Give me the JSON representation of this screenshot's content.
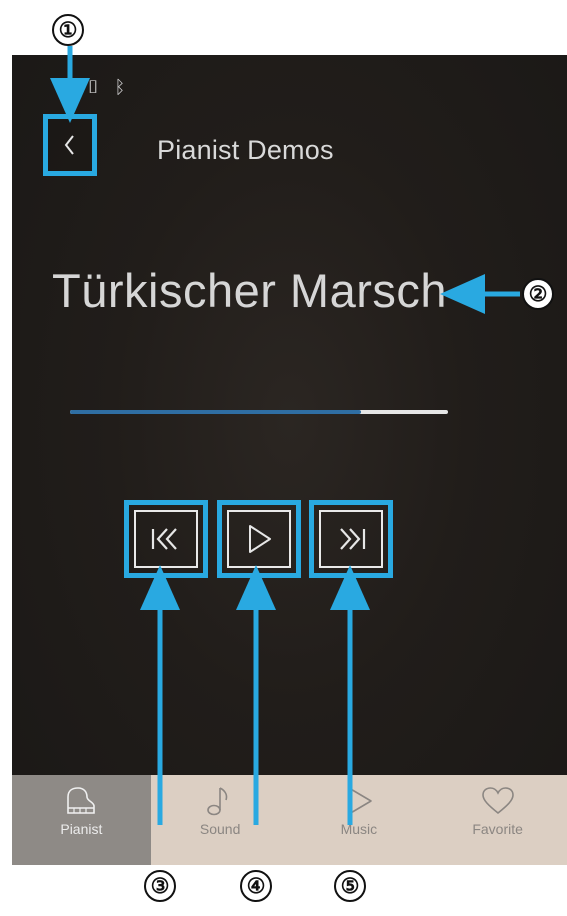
{
  "header": {
    "title": "Pianist Demos"
  },
  "now_playing": {
    "title": "Türkischer Marsch",
    "progress": 0.77
  },
  "tabs": [
    {
      "label": "Pianist",
      "icon": "piano-icon",
      "active": true
    },
    {
      "label": "Sound",
      "icon": "music-note-icon",
      "active": false
    },
    {
      "label": "Music",
      "icon": "play-icon",
      "active": false
    },
    {
      "label": "Favorite",
      "icon": "heart-icon",
      "active": false
    }
  ],
  "callouts": [
    "①",
    "②",
    "③",
    "④",
    "⑤"
  ],
  "colors": {
    "highlight": "#29a9e1",
    "progress": "#2f6ea3",
    "tabbar": "#dccfc3",
    "tab_active": "#8e8a86"
  }
}
